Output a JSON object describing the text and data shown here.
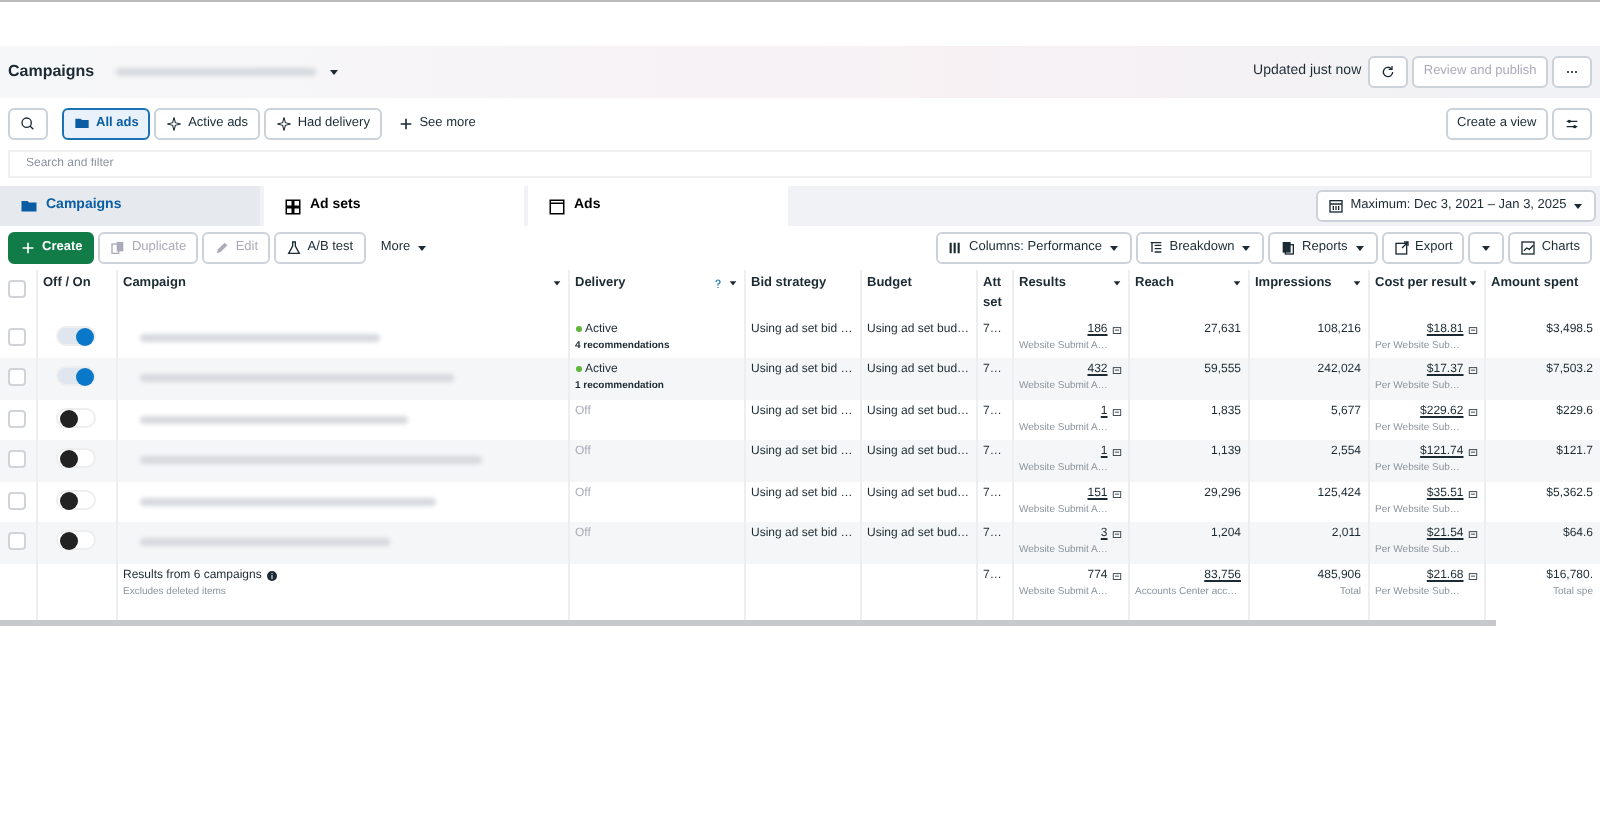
{
  "header": {
    "title": "Campaigns",
    "updated": "Updated just now",
    "publish": {
      "label": "Review and publish",
      "disabled": true
    }
  },
  "filters": {
    "items": [
      {
        "label": "All ads",
        "selected": true,
        "kind": "folder"
      },
      {
        "label": "Active ads",
        "selected": false,
        "kind": "spark"
      },
      {
        "label": "Had delivery",
        "selected": false,
        "kind": "spark"
      }
    ],
    "see_more": "See more",
    "create_view": "Create a view"
  },
  "search": {
    "placeholder": "Search and filter"
  },
  "tabs": [
    {
      "label": "Campaigns",
      "selected": true,
      "kind": "folder"
    },
    {
      "label": "Ad sets",
      "selected": false,
      "kind": "grid"
    },
    {
      "label": "Ads",
      "selected": false,
      "kind": "square"
    }
  ],
  "date_range": "Maximum: Dec 3, 2021 – Jan 3, 2025",
  "toolbar": {
    "left": [
      {
        "label": "Create",
        "kind": "create",
        "disabled": false
      },
      {
        "label": "Duplicate",
        "kind": "duplicate",
        "disabled": true
      },
      {
        "label": "Edit",
        "kind": "edit",
        "disabled": true
      },
      {
        "label": "A/B test",
        "kind": "flask",
        "disabled": false
      },
      {
        "label": "More",
        "kind": "more",
        "disabled": false
      }
    ],
    "right": [
      {
        "label": "Columns: Performance",
        "kind": "columns"
      },
      {
        "label": "Breakdown",
        "kind": "breakdown"
      },
      {
        "label": "Reports",
        "kind": "reports"
      },
      {
        "label": "Export",
        "kind": "export"
      },
      {
        "label": "Charts",
        "kind": "chart"
      }
    ]
  },
  "table": {
    "select_all_checked": false,
    "columns": [
      "Off / On",
      "Campaign",
      "Delivery",
      "Bid strategy",
      "Budget",
      "Att set",
      "Results",
      "Reach",
      "Impressions",
      "Cost per result",
      "Amount spent"
    ],
    "rows": [
      {
        "checked": false,
        "on": true,
        "delivery": {
          "status": "Active",
          "active": true,
          "note": "4 recommendations"
        },
        "bid": "Using ad set bid …",
        "budget": "Using ad set bud…",
        "attr": "7…",
        "results": "186",
        "results_sub": "Website Submit A…",
        "reach": "27,631",
        "impressions": "108,216",
        "cost": "$18.81",
        "cost_sub": "Per Website Sub…",
        "amount": "$3,498.5"
      },
      {
        "checked": false,
        "on": true,
        "delivery": {
          "status": "Active",
          "active": true,
          "note": "1 recommendation"
        },
        "bid": "Using ad set bid …",
        "budget": "Using ad set bud…",
        "attr": "7…",
        "results": "432",
        "results_sub": "Website Submit A…",
        "reach": "59,555",
        "impressions": "242,024",
        "cost": "$17.37",
        "cost_sub": "Per Website Sub…",
        "amount": "$7,503.2"
      },
      {
        "on": false,
        "delivery": {
          "status": "Off",
          "active": false
        },
        "bid": "Using ad set bid …",
        "budget": "Using ad set bud…",
        "attr": "7…",
        "results": "1",
        "results_sub": "Website Submit A…",
        "reach": "1,835",
        "checked": false,
        "impressions": "5,677",
        "cost": "$229.62",
        "cost_sub": "Per Website Sub…",
        "amount": "$229.6"
      },
      {
        "on": false,
        "delivery": {
          "status": "Off",
          "active": false
        },
        "bid": "Using ad set bid …",
        "budget": "Using ad set bud…",
        "attr": "7…",
        "results": "1",
        "results_sub": "Website Submit A…",
        "reach": "1,139",
        "checked": false,
        "impressions": "2,554",
        "cost": "$121.74",
        "cost_sub": "Per Website Sub…",
        "amount": "$121.7"
      },
      {
        "on": false,
        "delivery": {
          "status": "Off",
          "active": false
        },
        "bid": "Using ad set bid …",
        "budget": "Using ad set bud…",
        "attr": "7…",
        "results": "151",
        "results_sub": "Website Submit A…",
        "reach": "29,296",
        "checked": false,
        "impressions": "125,424",
        "cost": "$35.51",
        "cost_sub": "Per Website Sub…",
        "amount": "$5,362.5"
      },
      {
        "on": false,
        "delivery": {
          "status": "Off",
          "active": false
        },
        "bid": "Using ad set bid …",
        "budget": "Using ad set bud…",
        "attr": "7…",
        "results": "3",
        "results_sub": "Website Submit A…",
        "reach": "1,204",
        "checked": false,
        "impressions": "2,011",
        "cost": "$21.54",
        "cost_sub": "Per Website Sub…",
        "amount": "$64.6"
      }
    ],
    "footer": {
      "label": "Results from 6 campaigns",
      "sub": "Excludes deleted items",
      "attr": "7…",
      "results": "774",
      "results_sub": "Website Submit A…",
      "reach": "83,756",
      "reach_sub": "Accounts Center acc…",
      "impressions": "485,906",
      "impressions_sub": "Total",
      "cost": "$21.68",
      "cost_sub": "Per Website Sub…",
      "amount": "$16,780.",
      "amount_sub": "Total spe"
    }
  }
}
